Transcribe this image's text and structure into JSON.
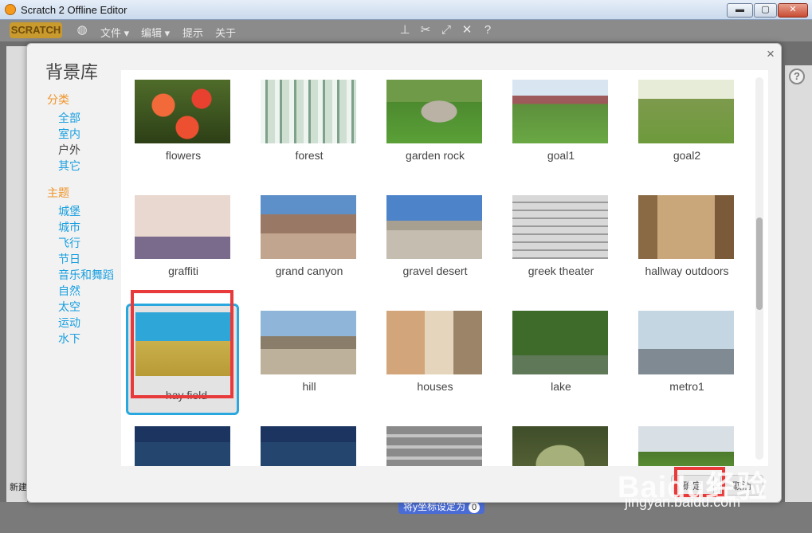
{
  "window": {
    "title": "Scratch 2 Offline Editor",
    "min": "▬",
    "max": "▢",
    "close": "✕"
  },
  "menubar": {
    "logo": "SCRATCH",
    "items": [
      "文件",
      "编辑",
      "提示",
      "关于"
    ]
  },
  "dialog": {
    "title": "背景库",
    "close": "×",
    "sidebar": {
      "category_header": "分类",
      "categories": [
        "全部",
        "室内",
        "户外",
        "其它"
      ],
      "selected_category": "户外",
      "theme_header": "主题",
      "themes": [
        "城堡",
        "城市",
        "飞行",
        "节日",
        "音乐和舞蹈",
        "自然",
        "太空",
        "运动",
        "水下"
      ]
    },
    "backdrops": [
      {
        "name": "flowers"
      },
      {
        "name": "forest"
      },
      {
        "name": "garden rock"
      },
      {
        "name": "goal1"
      },
      {
        "name": "goal2"
      },
      {
        "name": "graffiti"
      },
      {
        "name": "grand canyon"
      },
      {
        "name": "gravel desert"
      },
      {
        "name": "greek theater"
      },
      {
        "name": "hallway outdoors"
      },
      {
        "name": "hay field"
      },
      {
        "name": "hill"
      },
      {
        "name": "houses"
      },
      {
        "name": "lake"
      },
      {
        "name": "metro1"
      },
      {
        "name": ""
      },
      {
        "name": ""
      },
      {
        "name": ""
      },
      {
        "name": ""
      },
      {
        "name": ""
      }
    ],
    "selected_backdrop": "hay field",
    "ok_button": "确定",
    "cancel_button": "取消"
  },
  "background": {
    "new_label": "新建",
    "block_hint": "将y坐标设定为",
    "block_value": "0"
  },
  "watermark": {
    "text": "Baidu经验",
    "url": "jingyan.baidu.com"
  },
  "colors": {
    "accent": "#29a8e0",
    "category_header": "#f0952a",
    "highlight": "#e8393b"
  }
}
